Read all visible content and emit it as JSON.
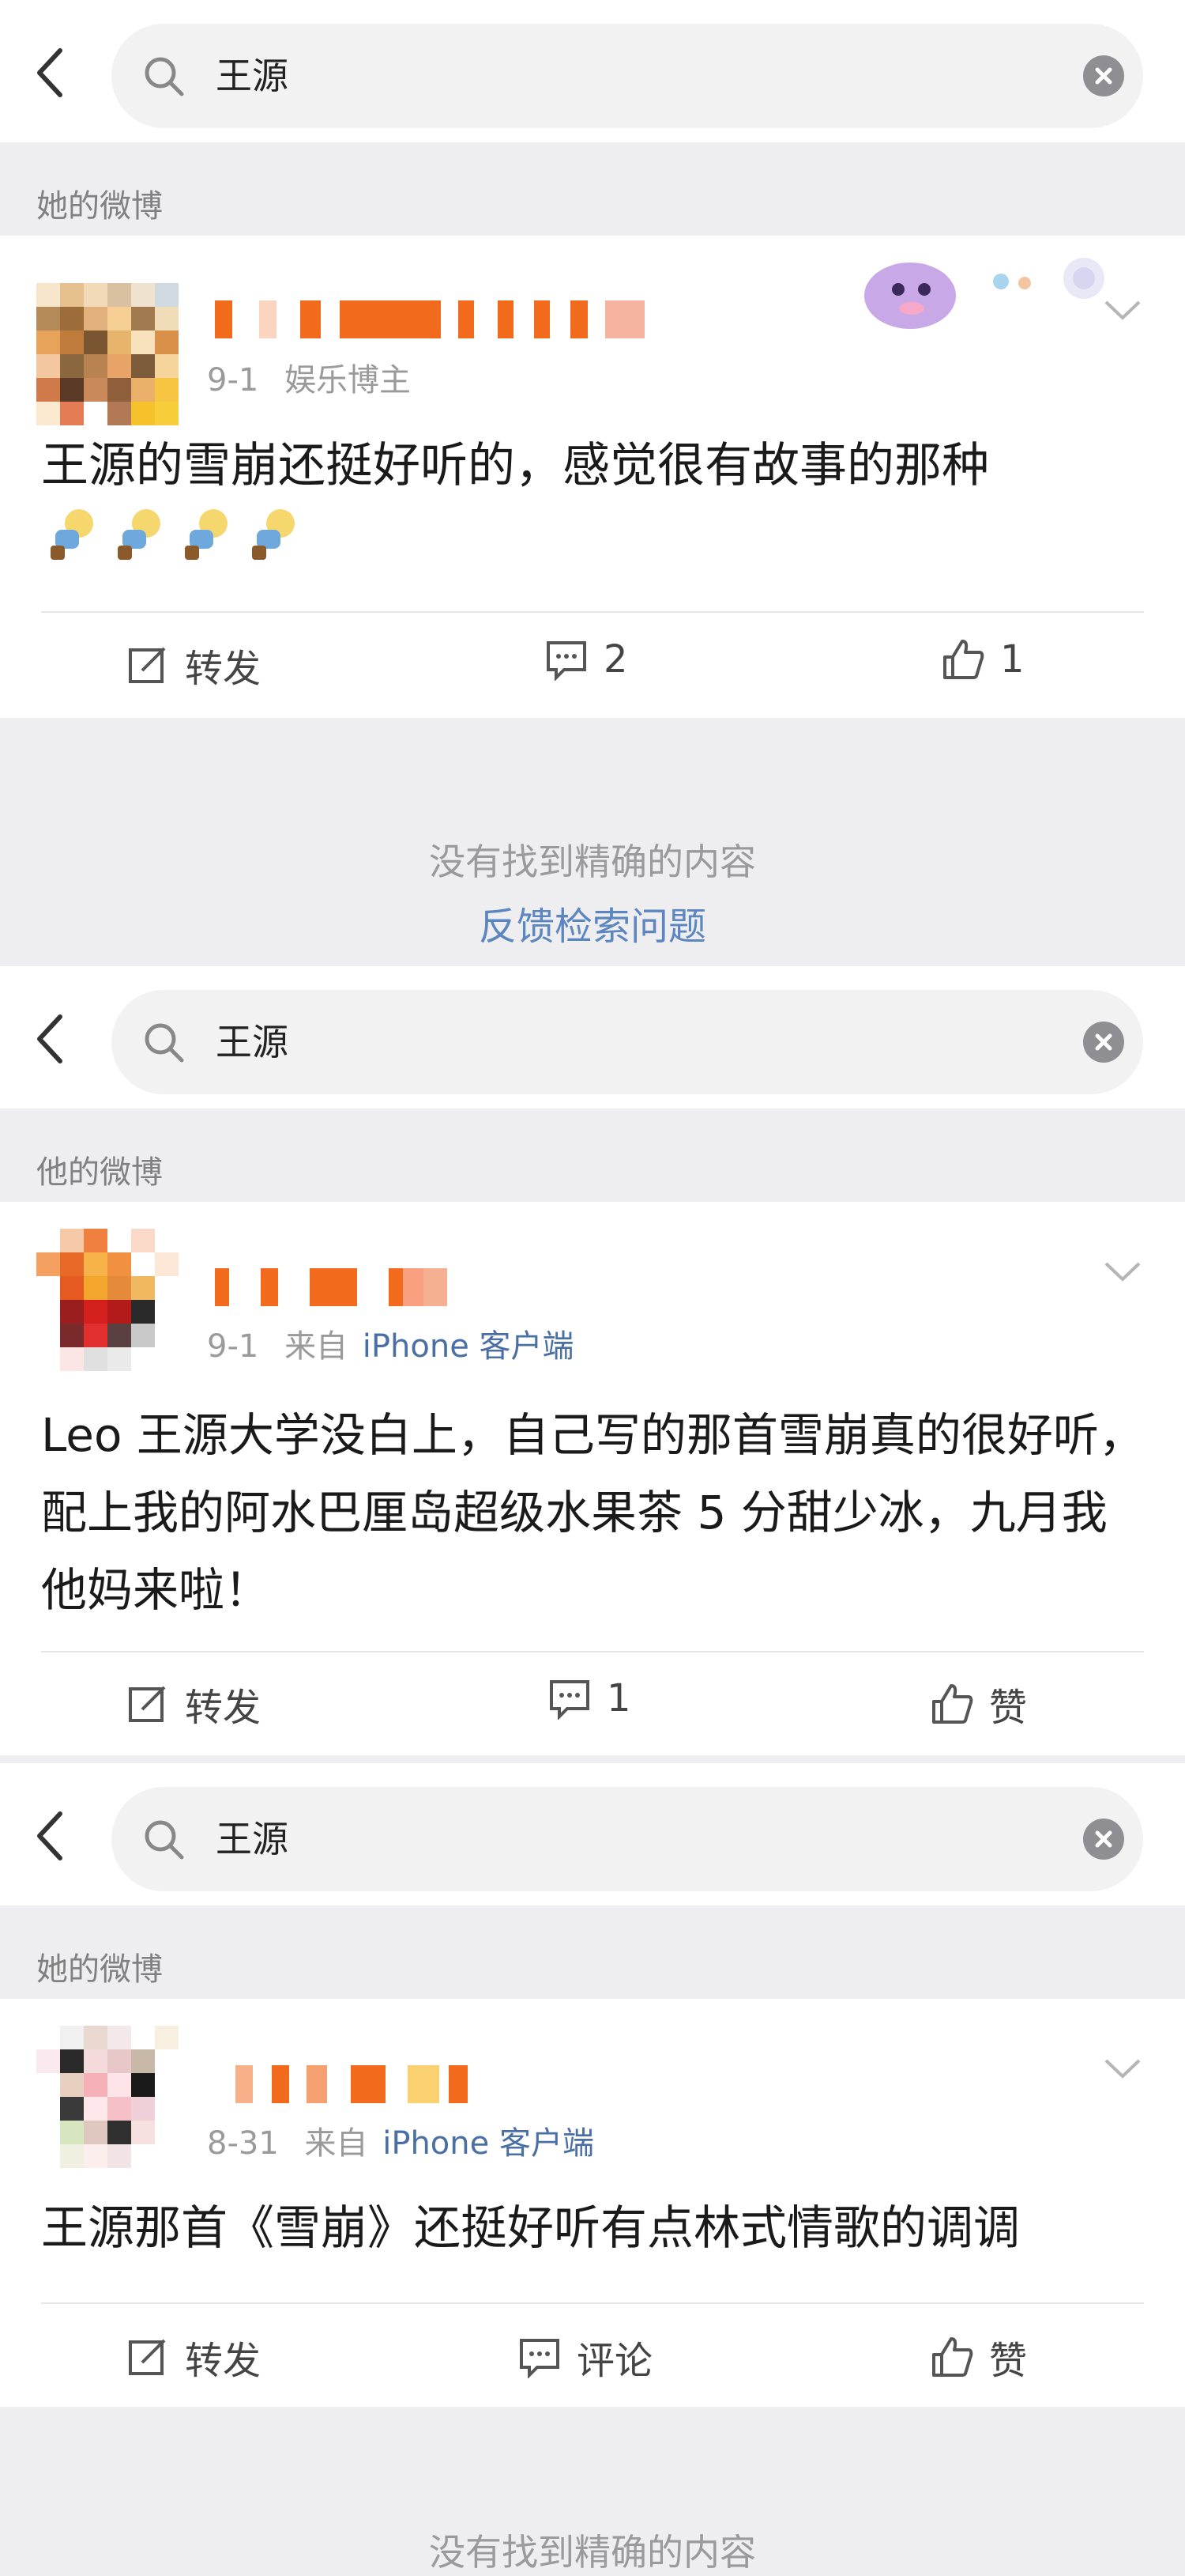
{
  "screens": [
    {
      "search_query": "王源",
      "section_label": "她的微博",
      "post": {
        "meta_time": "9-1",
        "meta_source": "娱乐博主",
        "text": "王源的雪崩还挺好听的，感觉很有故事的那种",
        "actions": {
          "repost": "转发",
          "comment": "2",
          "like": "1"
        }
      },
      "not_found": "没有找到精确的内容",
      "feedback_link": "反馈检索问题"
    },
    {
      "search_query": "王源",
      "section_label": "他的微博",
      "post": {
        "meta_time": "9-1",
        "meta_prefix": "来自",
        "meta_source": "iPhone 客户端",
        "text": "Leo 王源大学没白上，自己写的那首雪崩真的很好听，配上我的阿水巴厘岛超级水果茶 5 分甜少冰，九月我他妈来啦！",
        "actions": {
          "repost": "转发",
          "comment": "1",
          "like": "赞"
        }
      }
    },
    {
      "search_query": "王源",
      "section_label": "她的微博",
      "post": {
        "meta_time": "8-31",
        "meta_prefix": "来自",
        "meta_source": "iPhone 客户端",
        "text": "王源那首《雪崩》还挺好听有点林式情歌的调调",
        "actions": {
          "repost": "转发",
          "comment": "评论",
          "like": "赞"
        }
      },
      "not_found": "没有找到精确的内容"
    }
  ],
  "colors": {
    "background": "#eeeef0",
    "link": "#5b86c0",
    "source": "#4a6fa5",
    "username_blur": "#f26a1b"
  },
  "icons": [
    "back-arrow-icon",
    "search-icon",
    "clear-icon",
    "chevron-down-icon",
    "repost-icon",
    "comment-icon",
    "like-icon"
  ]
}
